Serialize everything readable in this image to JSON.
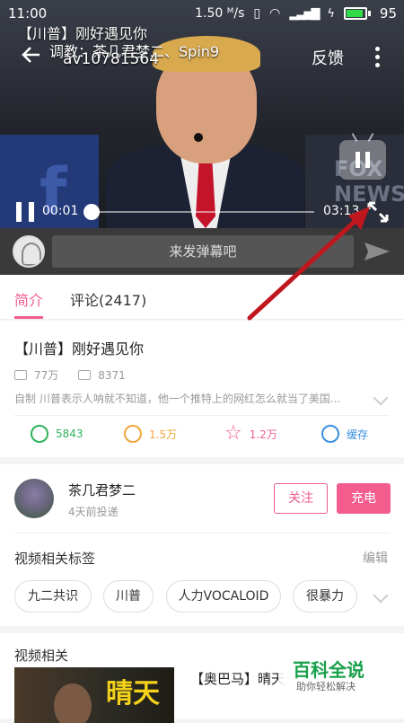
{
  "status": {
    "time": "11:00",
    "speed": "1.50 ᴹ/s",
    "battery": "95"
  },
  "video": {
    "overlay_title": "【川普】刚好遇见你",
    "tuning_credit": "调教：茶几君梦二、Spin9",
    "av_id": "av10781564",
    "feedback_label": "反馈",
    "bg_text_left": "f",
    "bg_text_right": "FOX NEWS",
    "current_time": "00:01",
    "total_time": "03:13",
    "progress": 0.005
  },
  "danmaku": {
    "placeholder": "来发弹幕吧"
  },
  "tabs": [
    {
      "label": "简介",
      "active": true
    },
    {
      "label": "评论(2417)",
      "active": false
    }
  ],
  "info": {
    "title": "【川普】刚好遇见你",
    "plays": "77万",
    "danmaku_count": "8371",
    "description": "自制 川普表示人呐就不知道，他一个推特上的网红怎么就当了美国..."
  },
  "actions": [
    {
      "label": "5843",
      "icon": "like-icon",
      "color": "#2fb35a"
    },
    {
      "label": "1.5万",
      "icon": "coin-icon",
      "color": "#f0a63b"
    },
    {
      "label": "1.2万",
      "icon": "star-icon",
      "color": "#f25d8e"
    },
    {
      "label": "缓存",
      "icon": "download-icon",
      "color": "#3a8fe0"
    }
  ],
  "uploader": {
    "name": "茶几君梦二",
    "time": "4天前投递",
    "follow_label": "关注",
    "charge_label": "充电"
  },
  "tags": {
    "title": "视频相关标签",
    "edit_label": "编辑",
    "items": [
      "九二共识",
      "川普",
      "人力VOCALOID",
      "很暴力"
    ]
  },
  "related": {
    "title": "视频相关",
    "thumb_text": "晴天",
    "item_title": "【奥巴马】晴天"
  },
  "watermark": {
    "title": "百科全说",
    "subtitle": "助你轻松解决"
  },
  "colors": {
    "accent": "#f25d8e",
    "annotation": "#c0161d"
  }
}
